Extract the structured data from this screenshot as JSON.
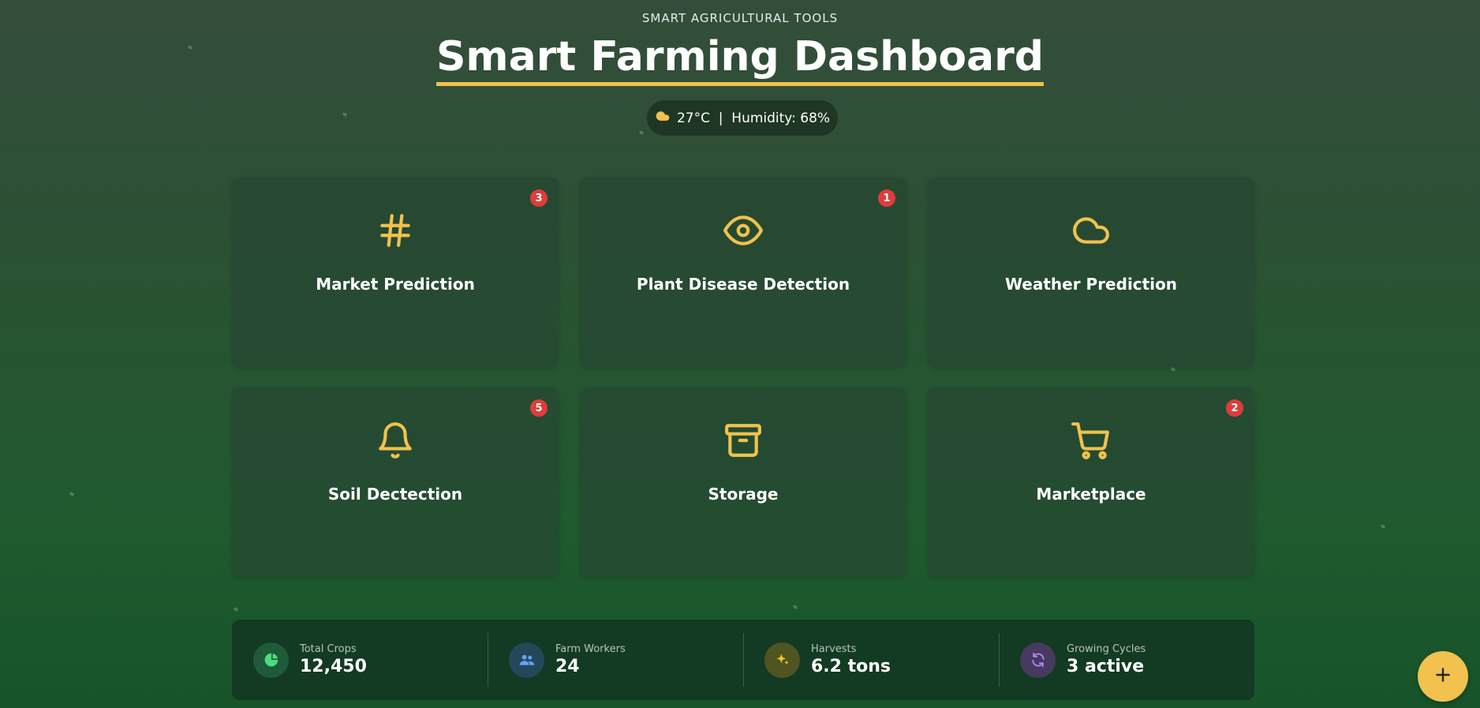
{
  "header": {
    "subtitle": "SMART AGRICULTURAL TOOLS",
    "title": "Smart Farming Dashboard"
  },
  "weather": {
    "icon": "cloud-icon",
    "text": "27°C  |  Humidity: 68%"
  },
  "cards": [
    {
      "icon": "hash-icon",
      "label": "Market Prediction",
      "badge": "3"
    },
    {
      "icon": "eye-icon",
      "label": "Plant Disease Detection",
      "badge": "1"
    },
    {
      "icon": "cloud-icon",
      "label": "Weather Prediction",
      "badge": ""
    },
    {
      "icon": "bell-icon",
      "label": "Soil Dectection",
      "badge": "5"
    },
    {
      "icon": "archive-icon",
      "label": "Storage",
      "badge": ""
    },
    {
      "icon": "shopping-cart-icon",
      "label": "Marketplace",
      "badge": "2"
    }
  ],
  "stats": [
    {
      "icon": "pie-chart-icon",
      "label": "Total Crops",
      "value": "12,450"
    },
    {
      "icon": "users-icon",
      "label": "Farm Workers",
      "value": "24"
    },
    {
      "icon": "sparkles-icon",
      "label": "Harvests",
      "value": "6.2 tons"
    },
    {
      "icon": "refresh-icon",
      "label": "Growing Cycles",
      "value": "3 active"
    }
  ],
  "fab": {
    "icon": "plus-icon"
  },
  "colors": {
    "accent": "#f2c14e",
    "badge": "#e03c3c",
    "stats_bg": "#133a22",
    "card_bg": "#26463a"
  }
}
